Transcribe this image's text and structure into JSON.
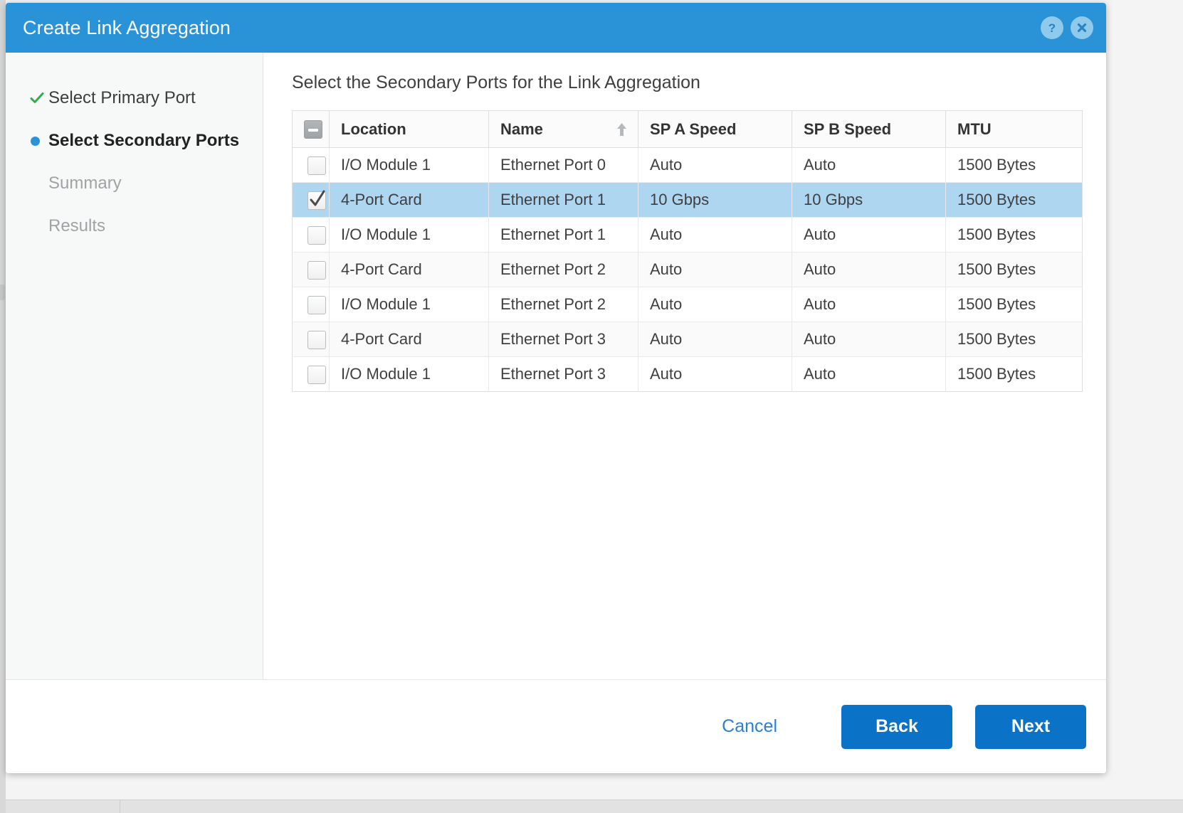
{
  "dialog": {
    "title": "Create Link Aggregation",
    "help_icon": "help-icon",
    "close_icon": "close-icon"
  },
  "sidebar": {
    "steps": [
      {
        "label": "Select Primary Port",
        "state": "done",
        "marker": "check-icon"
      },
      {
        "label": "Select Secondary Ports",
        "state": "active",
        "marker": "dot-icon"
      },
      {
        "label": "Summary",
        "state": "pending",
        "marker": "none"
      },
      {
        "label": "Results",
        "state": "pending",
        "marker": "none"
      }
    ]
  },
  "content": {
    "heading": "Select the Secondary Ports for the Link Aggregation",
    "table": {
      "select_all_state": "indeterminate",
      "sort_column": "Name",
      "sort_direction": "ascending",
      "columns": [
        "",
        "Location",
        "Name",
        "SP A Speed",
        "SP B Speed",
        "MTU"
      ],
      "rows": [
        {
          "checked": false,
          "selected": false,
          "location": "I/O Module 1",
          "name": "Ethernet Port 0",
          "sp_a_speed": "Auto",
          "sp_b_speed": "Auto",
          "mtu": "1500 Bytes"
        },
        {
          "checked": true,
          "selected": true,
          "location": "4-Port Card",
          "name": "Ethernet Port 1",
          "sp_a_speed": "10 Gbps",
          "sp_b_speed": "10 Gbps",
          "mtu": "1500 Bytes"
        },
        {
          "checked": false,
          "selected": false,
          "location": "I/O Module 1",
          "name": "Ethernet Port 1",
          "sp_a_speed": "Auto",
          "sp_b_speed": "Auto",
          "mtu": "1500 Bytes"
        },
        {
          "checked": false,
          "selected": false,
          "location": "4-Port Card",
          "name": "Ethernet Port 2",
          "sp_a_speed": "Auto",
          "sp_b_speed": "Auto",
          "mtu": "1500 Bytes"
        },
        {
          "checked": false,
          "selected": false,
          "location": "I/O Module 1",
          "name": "Ethernet Port 2",
          "sp_a_speed": "Auto",
          "sp_b_speed": "Auto",
          "mtu": "1500 Bytes"
        },
        {
          "checked": false,
          "selected": false,
          "location": "4-Port Card",
          "name": "Ethernet Port 3",
          "sp_a_speed": "Auto",
          "sp_b_speed": "Auto",
          "mtu": "1500 Bytes"
        },
        {
          "checked": false,
          "selected": false,
          "location": "I/O Module 1",
          "name": "Ethernet Port 3",
          "sp_a_speed": "Auto",
          "sp_b_speed": "Auto",
          "mtu": "1500 Bytes"
        }
      ]
    }
  },
  "footer": {
    "cancel_label": "Cancel",
    "back_label": "Back",
    "next_label": "Next"
  },
  "colors": {
    "titlebar_blue": "#2a92d6",
    "primary_button_blue": "#0a73c7",
    "link_blue": "#2a7fd4",
    "selected_row_blue": "#aed6f0",
    "step_done_green": "#2eaf4e",
    "step_active_blue": "#2a92d6"
  }
}
